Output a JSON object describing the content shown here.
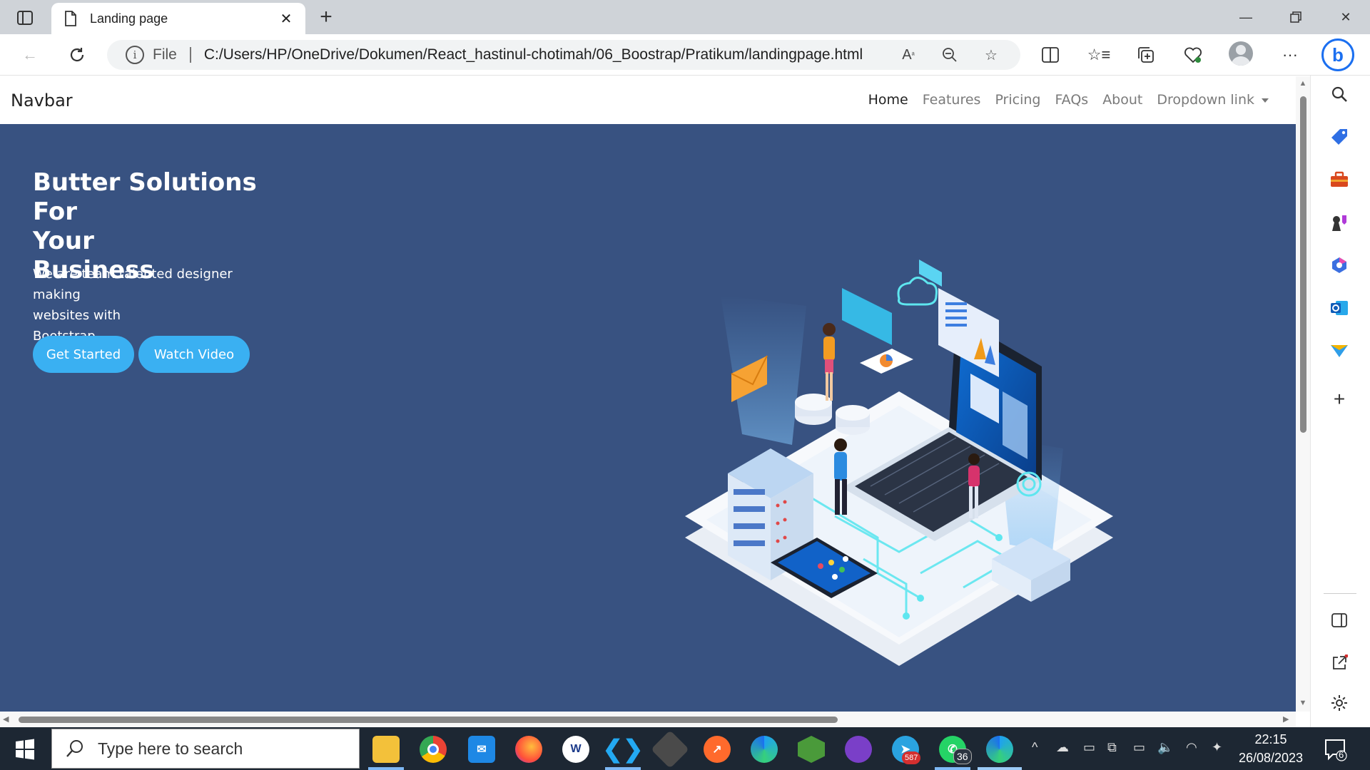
{
  "browser": {
    "tab_title": "Landing page",
    "url_scheme_label": "File",
    "url": "C:/Users/HP/OneDrive/Dokumen/React_hastinul-chotimah/06_Boostrap/Pratikum/landingpage.html"
  },
  "page": {
    "brand": "Navbar",
    "nav": [
      {
        "label": "Home",
        "active": true
      },
      {
        "label": "Features",
        "active": false
      },
      {
        "label": "Pricing",
        "active": false
      },
      {
        "label": "FAQs",
        "active": false
      },
      {
        "label": "About",
        "active": false
      },
      {
        "label": "Dropdown link",
        "active": false
      }
    ],
    "hero": {
      "title_lines": [
        "Butter Solutions For",
        "Your",
        "Business"
      ],
      "subtitle_lines": [
        "We are team talented designer making",
        "websites with",
        "Bootstrap"
      ],
      "cta_primary": "Get Started",
      "cta_secondary": "Watch Video",
      "background_color": "#385281",
      "button_color": "#3ab0f2"
    }
  },
  "taskbar": {
    "search_placeholder": "Type here to search",
    "telegram_badge": "587",
    "whatsapp_badge": "36",
    "time": "22:15",
    "date": "26/08/2023",
    "notification_count": "6"
  }
}
